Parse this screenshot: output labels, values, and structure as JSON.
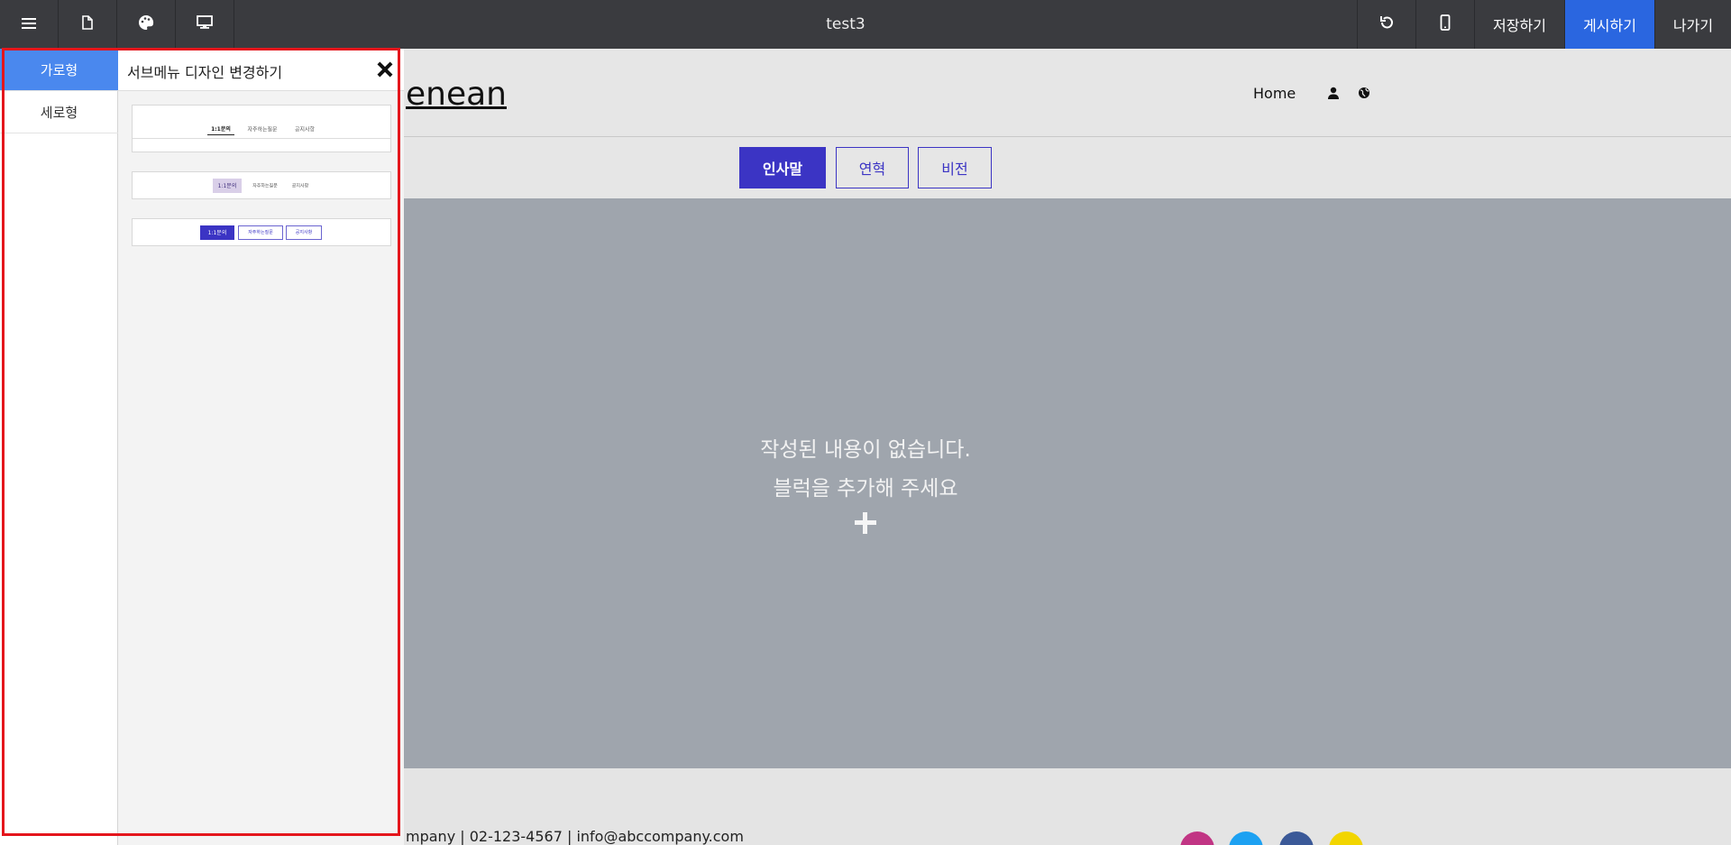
{
  "toolbar": {
    "title": "test3",
    "save_label": "저장하기",
    "publish_label": "게시하기",
    "exit_label": "나가기"
  },
  "site": {
    "logo_text": "enean",
    "nav_home": "Home",
    "submenu": [
      "인사말",
      "연혁",
      "비전"
    ],
    "empty_line1": "작성된 내용이 없습니다.",
    "empty_line2": "블럭을 추가해 주세요",
    "footer_text": "mpany | 02-123-4567 | info@abccompany.com"
  },
  "panel": {
    "tabs": [
      "가로형",
      "세로형"
    ],
    "title": "서브메뉴 디자인 변경하기",
    "presets": [
      {
        "items": [
          "1:1문의",
          "자주하는질문",
          "공지사항"
        ]
      },
      {
        "items": [
          "1:1문의",
          "자주하는질문",
          "공지사항"
        ]
      },
      {
        "items": [
          "1:1문의",
          "자주하는질문",
          "공지사항"
        ]
      }
    ]
  },
  "colors": {
    "toolbar_bg": "#3a3b3f",
    "publish_bg": "#2a66e0",
    "accent": "#3b34c4",
    "tab_active": "#4a88ee",
    "highlight": "#e4161c"
  }
}
